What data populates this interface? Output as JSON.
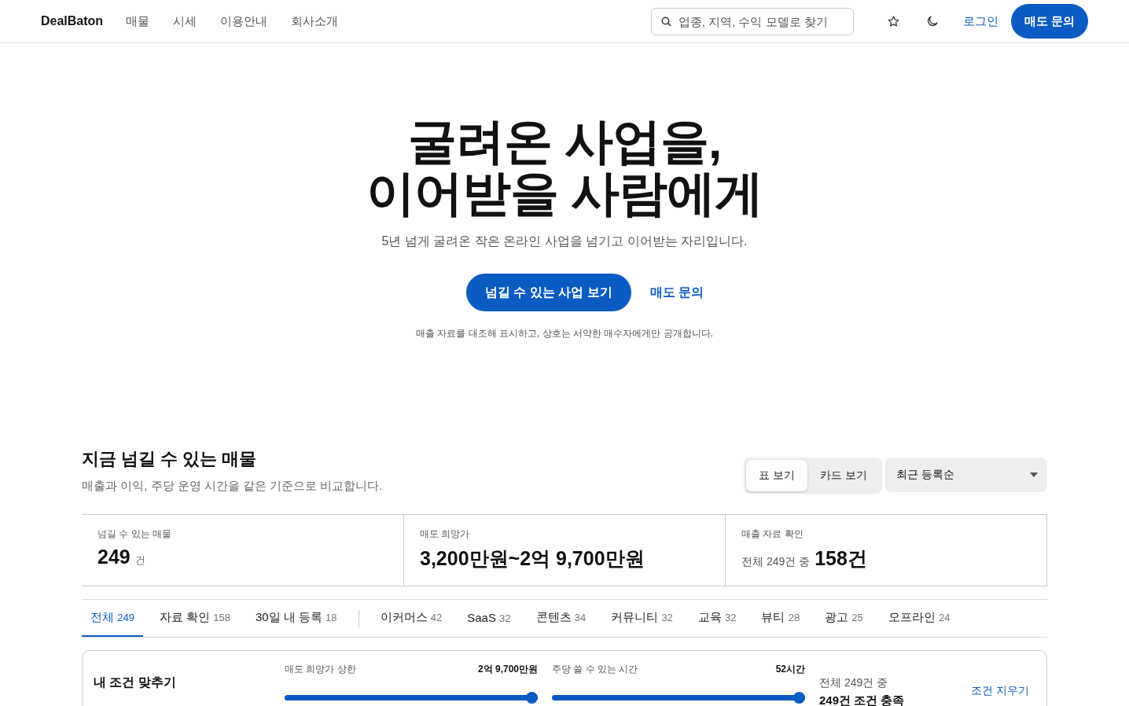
{
  "nav": {
    "logo": "DealBaton",
    "links": [
      "매물",
      "시세",
      "이용안내",
      "회사소개"
    ],
    "search": {
      "placeholder": "업종, 지역, 수익 모델로 찾기"
    },
    "login": "로그인",
    "cta": "매도 문의"
  },
  "hero": {
    "title_lines": [
      "굴려온 사업을,",
      "이어받을 사람에게"
    ],
    "subtitle": "5년 넘게 굴려온 작은 온라인 사업을 넘기고 이어받는 자리입니다.",
    "primary": "넘길 수 있는 사업 보기",
    "secondary": "매도 문의",
    "note": "매출 자료를 대조해 표시하고, 상호는 서약한 매수자에게만 공개합니다."
  },
  "listings": {
    "title": "지금 넘길 수 있는 매물",
    "subtitle": "매출과 이익, 주당 운영 시간을 같은 기준으로 비교합니다.",
    "views": [
      {
        "label": "표 보기",
        "selected": true
      },
      {
        "label": "카드 보기",
        "selected": false
      }
    ],
    "sort": "최근 등록순",
    "stats": [
      {
        "label": "넘길 수 있는 매물",
        "kind": "count",
        "value": "249",
        "unit": "건"
      },
      {
        "label": "매도 희망가",
        "kind": "range",
        "value": "3,200만원~2억 9,700만원"
      },
      {
        "label": "매출 자료 확인",
        "kind": "ratio",
        "prefix": "전체 249건 중",
        "value": "158건"
      }
    ],
    "status_filters": [
      {
        "label": "전체",
        "count": "249",
        "selected": true
      },
      {
        "label": "자료 확인",
        "count": "158",
        "selected": false
      },
      {
        "label": "30일 내 등록",
        "count": "18",
        "selected": false
      }
    ],
    "category_filters": [
      {
        "label": "이커머스",
        "count": "42",
        "selected": false
      },
      {
        "label": "SaaS",
        "count": "32",
        "selected": false
      },
      {
        "label": "콘텐츠",
        "count": "34",
        "selected": false
      },
      {
        "label": "커뮤니티",
        "count": "32",
        "selected": false
      },
      {
        "label": "교육",
        "count": "32",
        "selected": false
      },
      {
        "label": "뷰티",
        "count": "28",
        "selected": false
      },
      {
        "label": "광고",
        "count": "25",
        "selected": false
      },
      {
        "label": "오프라인",
        "count": "24",
        "selected": false
      }
    ],
    "conditions": {
      "title": "내 조건 맞추기",
      "sliders": [
        {
          "label": "매도 희망가 상한",
          "reading": "2억 9,700만원",
          "level": 1
        },
        {
          "label": "주당 쓸 수 있는 시간",
          "reading": "52시간",
          "level": 1
        }
      ],
      "total": "전체 249건 중",
      "matched": "249건 조건 충족",
      "clear": "조건 지우기"
    }
  }
}
